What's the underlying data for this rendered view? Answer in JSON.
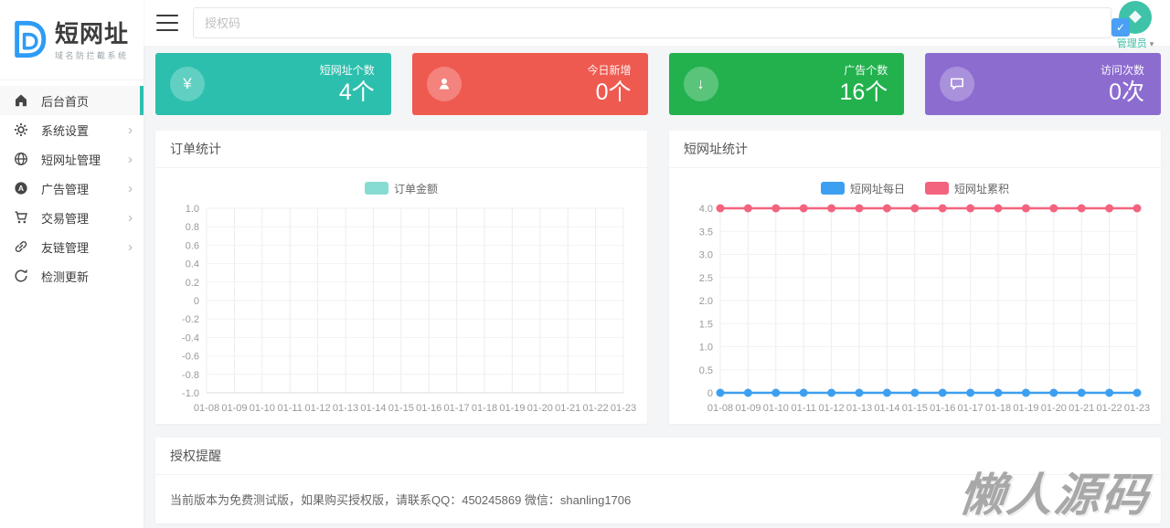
{
  "brand": {
    "name": "短网址",
    "subtitle": "域名防拦截系统"
  },
  "topbar": {
    "auth_placeholder": "授权码",
    "user_name": "管理员"
  },
  "icons": {
    "chevron_right": "›",
    "caret_down": "▾",
    "yen": "¥",
    "arrow_down": "↓",
    "check": "✓"
  },
  "sidebar": {
    "items": [
      {
        "label": "后台首页",
        "icon": "home-icon",
        "active": true,
        "has_children": false
      },
      {
        "label": "系统设置",
        "icon": "gear-icon",
        "active": false,
        "has_children": true
      },
      {
        "label": "短网址管理",
        "icon": "globe-icon",
        "active": false,
        "has_children": true
      },
      {
        "label": "广告管理",
        "icon": "ad-icon",
        "active": false,
        "has_children": true
      },
      {
        "label": "交易管理",
        "icon": "cart-icon",
        "active": false,
        "has_children": true
      },
      {
        "label": "友链管理",
        "icon": "link-icon",
        "active": false,
        "has_children": true
      },
      {
        "label": "检测更新",
        "icon": "refresh-icon",
        "active": false,
        "has_children": false
      }
    ]
  },
  "stat_cards": [
    {
      "label": "短网址个数",
      "value": "4个",
      "color": "#2dbfae",
      "icon": "yen-icon"
    },
    {
      "label": "今日新增",
      "value": "0个",
      "color": "#ef5a50",
      "icon": "user-icon"
    },
    {
      "label": "广告个数",
      "value": "16个",
      "color": "#23b14e",
      "icon": "arrow-down-icon"
    },
    {
      "label": "访问次数",
      "value": "0次",
      "color": "#8d6cd0",
      "icon": "chat-icon"
    }
  ],
  "panels": {
    "orders_title": "订单统计",
    "shorturl_title": "短网址统计",
    "license_title": "授权提醒",
    "license_text": "当前版本为免费测试版，如果购买授权版，请联系QQ：450245869 微信：shanling1706"
  },
  "watermark": "懒人源码",
  "chart_data": [
    {
      "type": "line",
      "title": "订单统计",
      "categories": [
        "01-08",
        "01-09",
        "01-10",
        "01-11",
        "01-12",
        "01-13",
        "01-14",
        "01-15",
        "01-16",
        "01-17",
        "01-18",
        "01-19",
        "01-20",
        "01-21",
        "01-22",
        "01-23"
      ],
      "series": [
        {
          "name": "订单金额",
          "color": "#86dcd2",
          "values": []
        }
      ],
      "ylim": [
        -1.0,
        1.0
      ],
      "yticks": [
        "1.0",
        "0.8",
        "0.6",
        "0.4",
        "0.2",
        "0",
        "-0.2",
        "-0.4",
        "-0.6",
        "-0.8",
        "-1.0"
      ],
      "legend_position": "top",
      "grid": true
    },
    {
      "type": "line",
      "title": "短网址统计",
      "categories": [
        "01-08",
        "01-09",
        "01-10",
        "01-11",
        "01-12",
        "01-13",
        "01-14",
        "01-15",
        "01-16",
        "01-17",
        "01-18",
        "01-19",
        "01-20",
        "01-21",
        "01-22",
        "01-23"
      ],
      "series": [
        {
          "name": "短网址每日",
          "color": "#3d9ff0",
          "values": [
            0,
            0,
            0,
            0,
            0,
            0,
            0,
            0,
            0,
            0,
            0,
            0,
            0,
            0,
            0,
            0
          ]
        },
        {
          "name": "短网址累积",
          "color": "#f4637e",
          "values": [
            4,
            4,
            4,
            4,
            4,
            4,
            4,
            4,
            4,
            4,
            4,
            4,
            4,
            4,
            4,
            4
          ]
        }
      ],
      "ylim": [
        0,
        4.0
      ],
      "yticks": [
        "4.0",
        "3.5",
        "3.0",
        "2.5",
        "2.0",
        "1.5",
        "1.0",
        "0.5",
        "0"
      ],
      "legend_position": "top",
      "grid": true
    }
  ]
}
